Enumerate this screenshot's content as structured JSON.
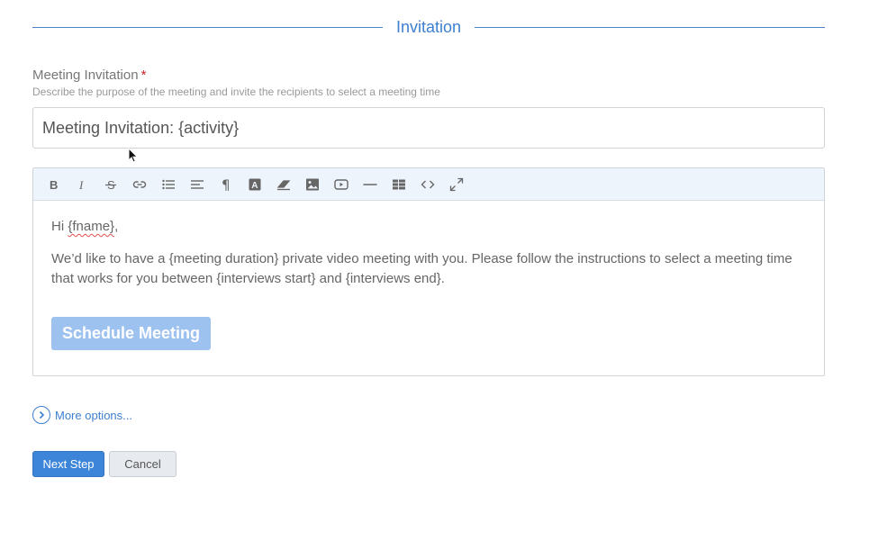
{
  "section": {
    "title": "Invitation"
  },
  "field": {
    "label": "Meeting Invitation",
    "required_mark": "*",
    "help": "Describe the purpose of the meeting and invite the recipients to select a meeting time"
  },
  "subject": {
    "value": "Meeting Invitation: {activity}"
  },
  "toolbar": {
    "icons": [
      "bold-icon",
      "italic-icon",
      "strikethrough-icon",
      "link-icon",
      "bullet-list-icon",
      "align-icon",
      "paragraph-icon",
      "text-color-icon",
      "eraser-icon",
      "image-icon",
      "video-icon",
      "horizontal-rule-icon",
      "table-icon",
      "code-icon",
      "fullscreen-icon"
    ]
  },
  "editor": {
    "greeting_prefix": "Hi ",
    "greeting_var": "{fname}",
    "greeting_suffix": ",",
    "body": "We’d like to have a {meeting duration} private video meeting with you. Please follow the instructions to select a meeting time that works for you between {interviews start} and {interviews end}.",
    "schedule_button": "Schedule Meeting"
  },
  "more_options": {
    "label": "More options..."
  },
  "actions": {
    "next": "Next Step",
    "cancel": "Cancel"
  },
  "colors": {
    "accent": "#3d7fd0",
    "primary_button": "#3d85d8",
    "disabled_button": "#9ec2ef"
  }
}
